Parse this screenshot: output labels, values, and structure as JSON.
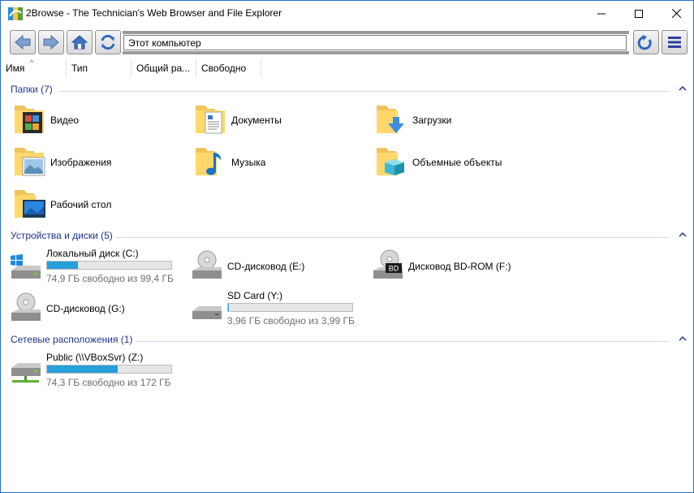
{
  "window": {
    "title": "2Browse - The Technician's Web Browser and File Explorer"
  },
  "toolbar": {
    "address_value": "Этот компьютер"
  },
  "columns": [
    "Имя",
    "Тип",
    "Общий ра...",
    "Свободно"
  ],
  "groups": {
    "folders": {
      "title": "Папки (7)",
      "items": [
        "Видео",
        "Документы",
        "Загрузки",
        "Изображения",
        "Музыка",
        "Объемные объекты",
        "Рабочий стол"
      ]
    },
    "devices": {
      "title": "Устройства и диски (5)",
      "items": [
        {
          "label": "Локальный диск (C:)",
          "sub": "74,9 ГБ свободно из 99,4 ГБ",
          "used_fraction": 0.247
        },
        {
          "label": "CD-дисковод (E:)"
        },
        {
          "label": "Дисковод BD-ROM (F:)"
        },
        {
          "label": "CD-дисковод (G:)"
        },
        {
          "label": "SD Card (Y:)",
          "sub": "3,96 ГБ свободно из 3,99 ГБ",
          "used_fraction": 0.008
        }
      ]
    },
    "network": {
      "title": "Сетевые расположения (1)",
      "items": [
        {
          "label": "Public (\\\\VBoxSvr) (Z:)",
          "sub": "74,3 ГБ свободно из 172 ГБ",
          "used_fraction": 0.568
        }
      ]
    }
  },
  "icons": {
    "bd_badge": "BD"
  },
  "colors": {
    "accent": "#26a0da",
    "group_title": "#1e3287",
    "window_border": "#2b6cc4"
  }
}
